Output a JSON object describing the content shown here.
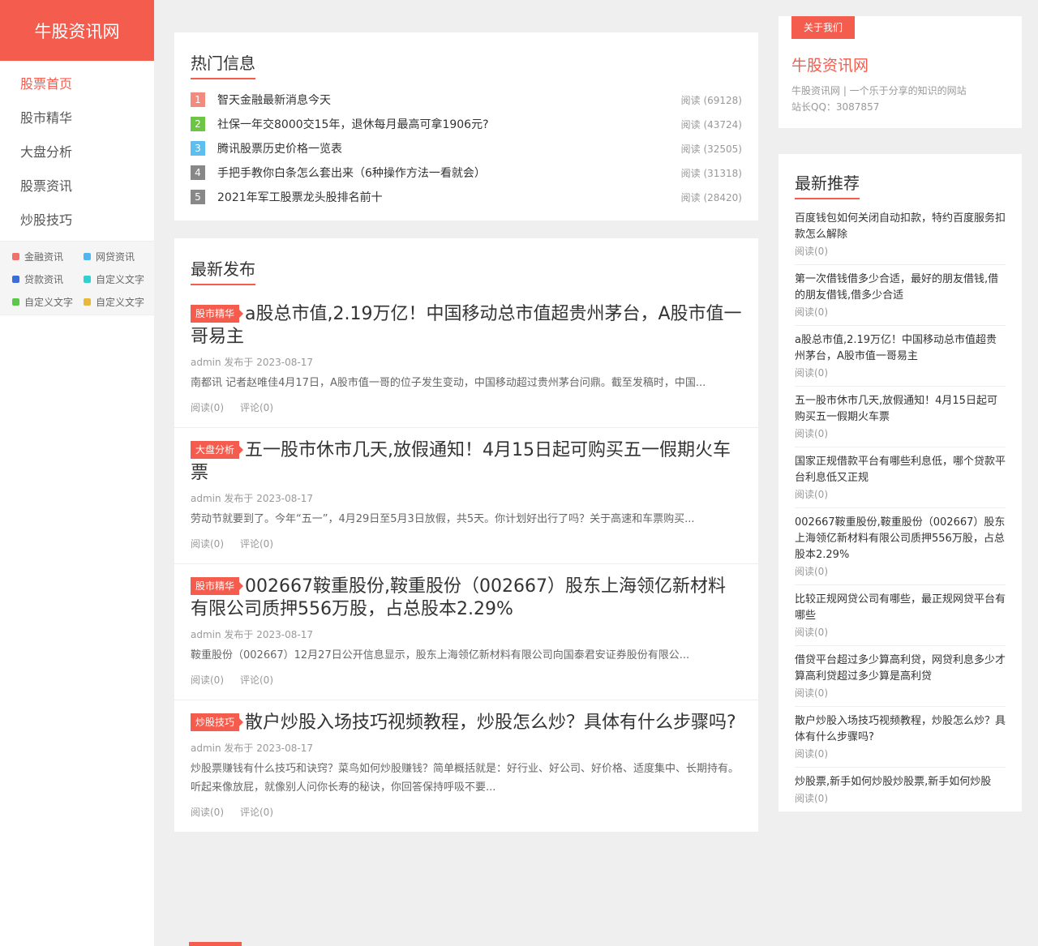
{
  "site": {
    "logo": "牛股资讯网"
  },
  "nav": [
    {
      "label": "股票首页"
    },
    {
      "label": "股市精华"
    },
    {
      "label": "大盘分析"
    },
    {
      "label": "股票资讯"
    },
    {
      "label": "炒股技巧"
    }
  ],
  "tags": [
    {
      "label": "金融资讯",
      "color": "#f07070"
    },
    {
      "label": "网贷资讯",
      "color": "#4fb6f0"
    },
    {
      "label": "贷款资讯",
      "color": "#3b6fd8"
    },
    {
      "label": "自定义文字",
      "color": "#2ed0d0"
    },
    {
      "label": "自定义文字",
      "color": "#5cc84a"
    },
    {
      "label": "自定义文字",
      "color": "#e8b83a"
    }
  ],
  "hot": {
    "title": "热门信息",
    "items": [
      {
        "rank": "1",
        "color": "#f28a7e",
        "title": "智天金融最新消息今天",
        "read": "阅读 (69128)"
      },
      {
        "rank": "2",
        "color": "#6cc644",
        "title": "社保一年交8000交15年，退休每月最高可拿1906元?",
        "read": "阅读 (43724)"
      },
      {
        "rank": "3",
        "color": "#5bc0f0",
        "title": "腾讯股票历史价格一览表",
        "read": "阅读 (32505)"
      },
      {
        "rank": "4",
        "color": "#888888",
        "title": "手把手教你白条怎么套出来（6种操作方法一看就会）",
        "read": "阅读 (31318)"
      },
      {
        "rank": "5",
        "color": "#888888",
        "title": "2021年军工股票龙头股排名前十",
        "read": "阅读 (28420)"
      }
    ]
  },
  "latest": {
    "title": "最新发布",
    "posts": [
      {
        "category": "股市精华",
        "title": "a股总市值,2.19万亿！中国移动总市值超贵州茅台，A股市值一哥易主",
        "meta": "admin 发布于 2023-08-17",
        "excerpt": "南都讯 记者赵唯佳4月17日，A股市值一哥的位子发生变动，中国移动超过贵州茅台问鼎。截至发稿时，中国...",
        "read": "阅读(0)",
        "comment": "评论(0)"
      },
      {
        "category": "大盘分析",
        "title": "五一股市休市几天,放假通知！4月15日起可购买五一假期火车票",
        "meta": "admin 发布于 2023-08-17",
        "excerpt": "劳动节就要到了。今年“五一”，4月29日至5月3日放假，共5天。你计划好出行了吗？关于高速和车票购买...",
        "read": "阅读(0)",
        "comment": "评论(0)"
      },
      {
        "category": "股市精华",
        "title": "002667鞍重股份,鞍重股份（002667）股东上海领亿新材料有限公司质押556万股，占总股本2.29%",
        "meta": "admin 发布于 2023-08-17",
        "excerpt": "鞍重股份（002667）12月27日公开信息显示，股东上海领亿新材料有限公司向国泰君安证券股份有限公...",
        "read": "阅读(0)",
        "comment": "评论(0)"
      },
      {
        "category": "炒股技巧",
        "title": "散户炒股入场技巧视频教程，炒股怎么炒？具体有什么步骤吗?",
        "meta": "admin 发布于 2023-08-17",
        "excerpt": "炒股票赚钱有什么技巧和诀窍？菜鸟如何炒股赚钱？简单概括就是：好行业、好公司、好价格、适度集中、长期持有。听起来像放屁，就像别人问你长寿的秘诀，你回答保持呼吸不要...",
        "read": "阅读(0)",
        "comment": "评论(0)"
      }
    ]
  },
  "about": {
    "tab": "关于我们",
    "name": "牛股资讯网",
    "desc": "牛股资讯网 | 一个乐于分享的知识的网站",
    "qq": "站长QQ：3087857"
  },
  "recommend": {
    "title": "最新推荐",
    "items": [
      {
        "title": "百度钱包如何关闭自动扣款，特约百度服务扣款怎么解除",
        "read": "阅读(0)"
      },
      {
        "title": "第一次借钱借多少合适，最好的朋友借钱,借的朋友借钱,借多少合适",
        "read": "阅读(0)"
      },
      {
        "title": "a股总市值,2.19万亿！中国移动总市值超贵州茅台，A股市值一哥易主",
        "read": "阅读(0)"
      },
      {
        "title": "五一股市休市几天,放假通知！4月15日起可购买五一假期火车票",
        "read": "阅读(0)"
      },
      {
        "title": "国家正规借款平台有哪些利息低，哪个贷款平台利息低又正规",
        "read": "阅读(0)"
      },
      {
        "title": "002667鞍重股份,鞍重股份（002667）股东上海领亿新材料有限公司质押556万股，占总股本2.29%",
        "read": "阅读(0)"
      },
      {
        "title": "比较正规网贷公司有哪些，最正规网贷平台有哪些",
        "read": "阅读(0)"
      },
      {
        "title": "借贷平台超过多少算高利贷，网贷利息多少才算高利贷超过多少算是高利贷",
        "read": "阅读(0)"
      },
      {
        "title": "散户炒股入场技巧视频教程，炒股怎么炒？具体有什么步骤吗?",
        "read": "阅读(0)"
      },
      {
        "title": "炒股票,新手如何炒股炒股票,新手如何炒股",
        "read": "阅读(0)"
      }
    ]
  }
}
